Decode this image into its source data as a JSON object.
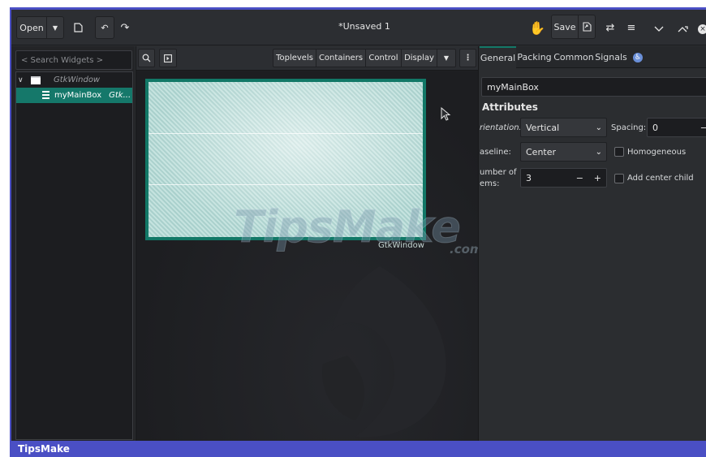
{
  "header": {
    "open_label": "Open",
    "title": "*Unsaved 1",
    "save_label": "Save"
  },
  "left": {
    "search_placeholder": "< Search Widgets >",
    "tree": [
      {
        "name": "",
        "class": "GtkWindow"
      },
      {
        "name": "myMainBox",
        "class": "Gtk..."
      }
    ]
  },
  "center": {
    "segments": [
      "Toplevels",
      "Containers",
      "Control",
      "Display"
    ],
    "window_label": "GtkWindow",
    "watermark": "TipsMake",
    "watermark_suffix": ".com"
  },
  "right": {
    "tabs": [
      "General",
      "Packing",
      "Common",
      "Signals"
    ],
    "id_value": "myMainBox",
    "section_title": "Attributes",
    "orientation_label": "rientation:",
    "orientation_value": "Vertical",
    "spacing_label": "Spacing:",
    "spacing_value": "0",
    "baseline_label": "aseline:",
    "baseline_value": "Center",
    "homogeneous_label": "Homogeneous",
    "items_label_1": "umber of",
    "items_label_2": "ems:",
    "items_value": "3",
    "center_child_label": "Add center child"
  },
  "footer": {
    "brand": "TipsMake"
  },
  "colors": {
    "accent": "#127867",
    "selection": "#15786a",
    "frame": "#4a4fc4"
  },
  "icons": [
    "dropdown-arrow-icon",
    "new-document-icon",
    "undo-icon",
    "redo-icon",
    "hand-pointer-icon",
    "export-icon",
    "swap-icon",
    "menu-icon",
    "minimize-icon",
    "maximize-icon",
    "close-icon",
    "search-icon",
    "preview-icon",
    "more-vertical-icon",
    "accessibility-icon",
    "chevron-down-icon",
    "window-icon",
    "box-icon",
    "cursor-icon"
  ]
}
